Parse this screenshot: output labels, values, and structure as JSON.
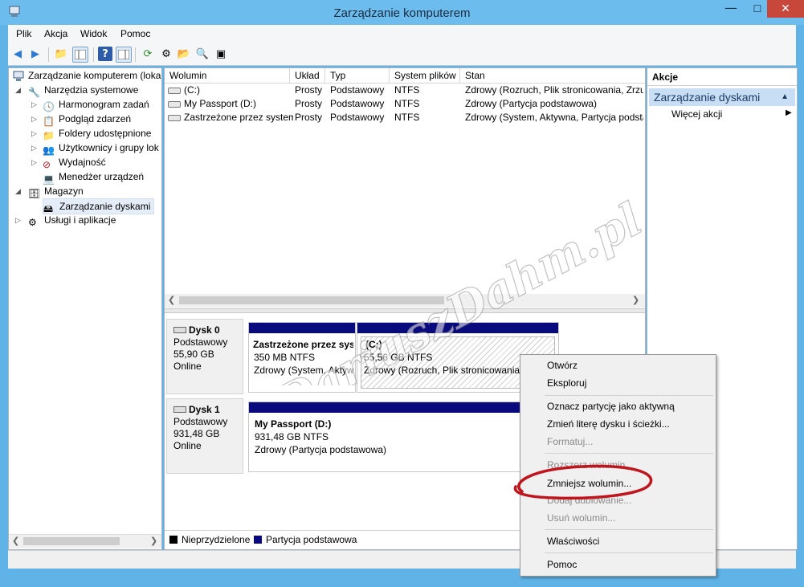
{
  "window": {
    "title": "Zarządzanie komputerem",
    "minimize": "—",
    "maximize": "☐",
    "close": "✕"
  },
  "menu": [
    "Plik",
    "Akcja",
    "Widok",
    "Pomoc"
  ],
  "tree": {
    "root": "Zarządzanie komputerem (loka",
    "system_tools": "Narzędzia systemowe",
    "scheduler": "Harmonogram zadań",
    "event_viewer": "Podgląd zdarzeń",
    "shared_folders": "Foldery udostępnione",
    "users_groups": "Użytkownicy i grupy lok",
    "performance": "Wydajność",
    "device_manager": "Menedżer urządzeń",
    "storage": "Magazyn",
    "disk_management": "Zarządzanie dyskami",
    "services_apps": "Usługi i aplikacje"
  },
  "volumes": {
    "columns": [
      "Wolumin",
      "Układ",
      "Typ",
      "System plików",
      "Stan"
    ],
    "rows": [
      [
        "(C:)",
        "Prosty",
        "Podstawowy",
        "NTFS",
        "Zdrowy (Rozruch, Plik stronicowania, Zrzu"
      ],
      [
        "My Passport (D:)",
        "Prosty",
        "Podstawowy",
        "NTFS",
        "Zdrowy (Partycja podstawowa)"
      ],
      [
        "Zastrzeżone przez system",
        "Prosty",
        "Podstawowy",
        "NTFS",
        "Zdrowy (System, Aktywna, Partycja podsta"
      ]
    ]
  },
  "disks": [
    {
      "name": "Dysk 0",
      "type": "Podstawowy",
      "size": "55,90 GB",
      "status": "Online",
      "parts": [
        {
          "title": "Zastrzeżone przez sys",
          "size": "350 MB NTFS",
          "state": "Zdrowy (System, Aktyw"
        },
        {
          "title": "(C:)",
          "size": "55,56 GB NTFS",
          "state": "Zdrowy (Rozruch, Plik stronicowania,"
        }
      ]
    },
    {
      "name": "Dysk 1",
      "type": "Podstawowy",
      "size": "931,48 GB",
      "status": "Online",
      "parts": [
        {
          "title": "My Passport  (D:)",
          "size": "931,48 GB NTFS",
          "state": "Zdrowy (Partycja podstawowa)"
        }
      ]
    }
  ],
  "legend": {
    "unallocated": "Nieprzydzielone",
    "primary": "Partycja podstawowa"
  },
  "actions": {
    "title": "Akcje",
    "section": "Zarządzanie dyskami",
    "more": "Więcej akcji"
  },
  "context_menu": {
    "open": "Otwórz",
    "explore": "Eksploruj",
    "mark_active": "Oznacz partycję jako aktywną",
    "change_letter": "Zmień literę dysku i ścieżki...",
    "format": "Formatuj...",
    "extend": "Rozszerz wolumin...",
    "shrink": "Zmniejsz wolumin...",
    "mirror": "Dodaj dublowanie...",
    "delete": "Usuń wolumin...",
    "properties": "Właściwości",
    "help": "Pomoc"
  },
  "watermark": "DariuszDahm.pl",
  "colors": {
    "titlebar": "#6cbcee",
    "close": "#c7473b",
    "partition": "#0a0a7f",
    "highlight": "#c7def4",
    "annotation": "#c0151c"
  }
}
